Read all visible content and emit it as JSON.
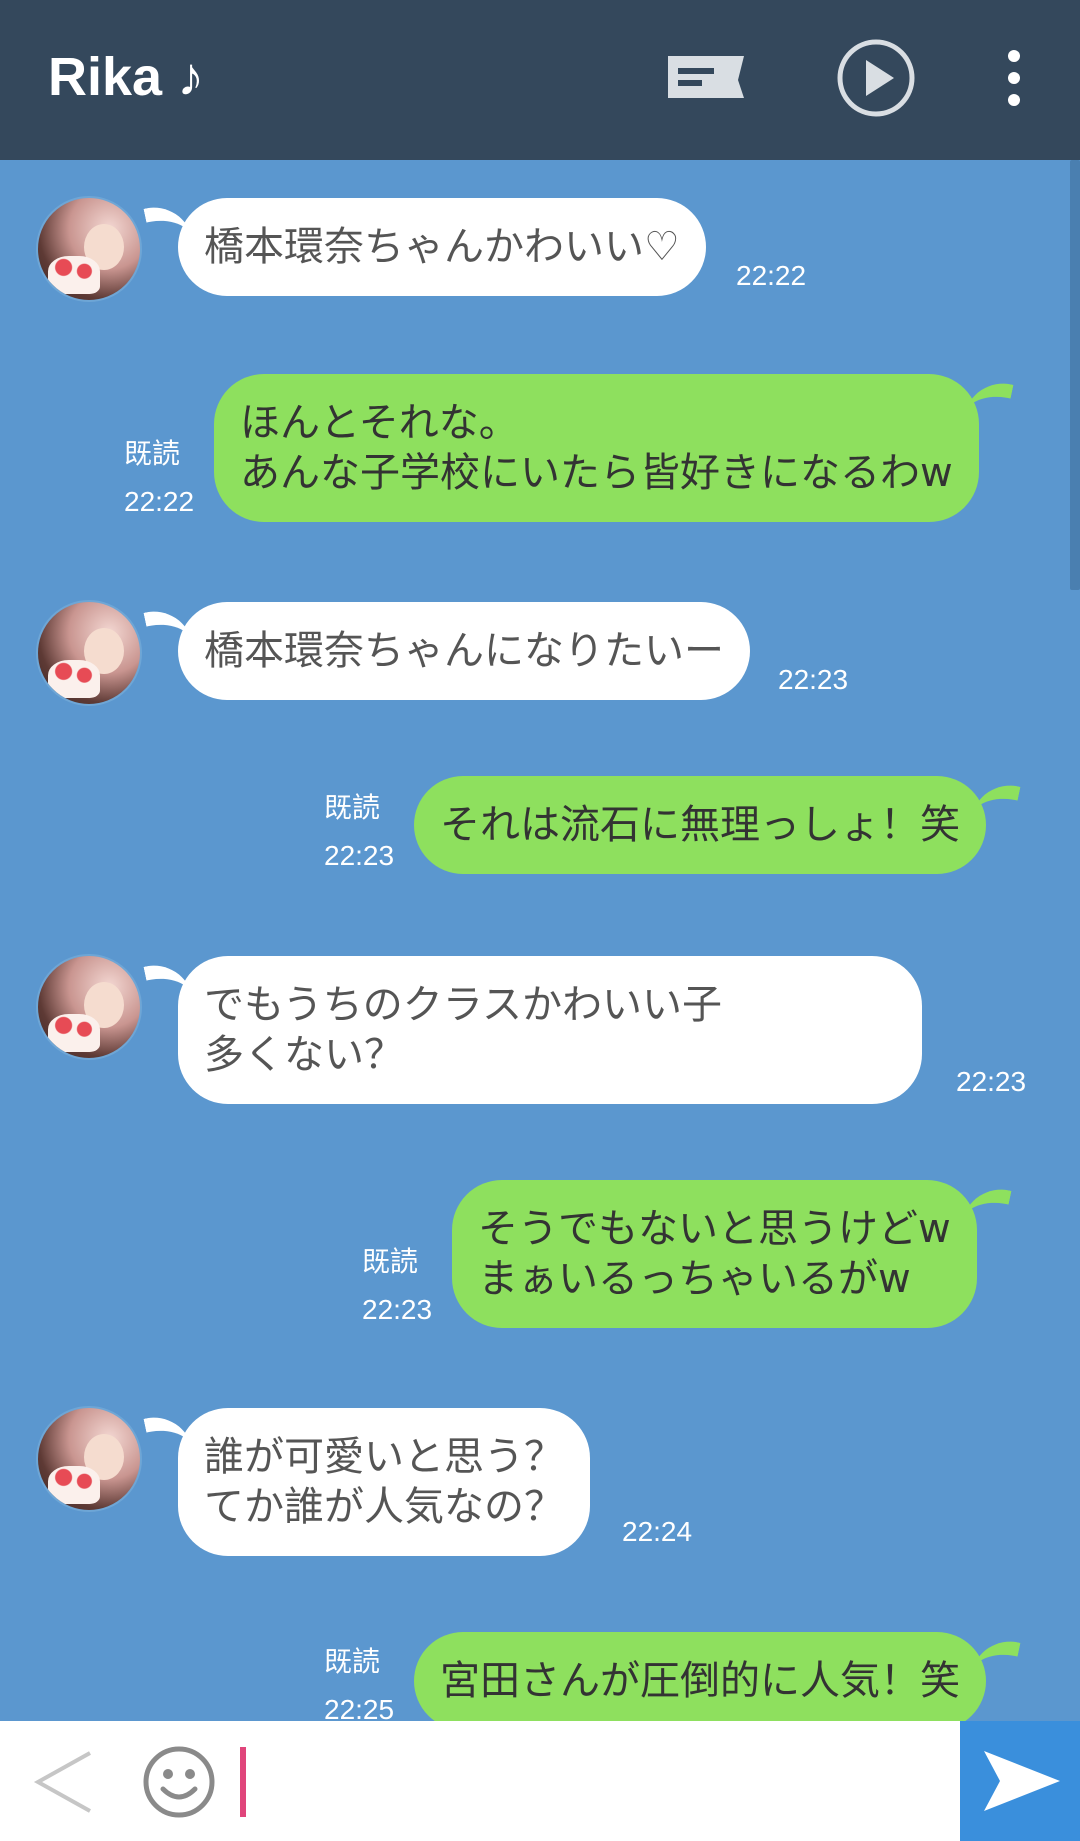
{
  "header": {
    "title": "Rika ♪",
    "icons": [
      "notes-icon",
      "play-icon",
      "more-vertical-icon"
    ]
  },
  "messages": [
    {
      "side": "in",
      "lines": [
        "橋本環奈ちゃんかわいい♡"
      ],
      "time": "22:22"
    },
    {
      "side": "out",
      "lines": [
        "ほんとそれな。",
        "あんな子学校にいたら皆好きになるわw"
      ],
      "read": "既読",
      "time": "22:22"
    },
    {
      "side": "in",
      "lines": [
        "橋本環奈ちゃんになりたいー"
      ],
      "time": "22:23"
    },
    {
      "side": "out",
      "lines": [
        "それは流石に無理っしょ！笑"
      ],
      "read": "既読",
      "time": "22:23"
    },
    {
      "side": "in",
      "lines": [
        "でもうちのクラスかわいい子",
        "多くない？"
      ],
      "time": "22:23"
    },
    {
      "side": "out",
      "lines": [
        "そうでもないと思うけどw",
        "まぁいるっちゃいるがw"
      ],
      "read": "既読",
      "time": "22:23"
    },
    {
      "side": "in",
      "lines": [
        "誰が可愛いと思う？",
        "てか誰が人気なの？"
      ],
      "time": "22:24"
    },
    {
      "side": "out",
      "lines": [
        "宮田さんが圧倒的に人気！笑"
      ],
      "read": "既読",
      "time": "22:25"
    }
  ],
  "input": {
    "value": "",
    "placeholder": ""
  },
  "colors": {
    "header_bg": "#34485c",
    "chat_bg": "#5b97cf",
    "incoming_bubble": "#ffffff",
    "outgoing_bubble": "#8ee05e",
    "send_button": "#3a8fdc",
    "caret": "#e0457b"
  }
}
